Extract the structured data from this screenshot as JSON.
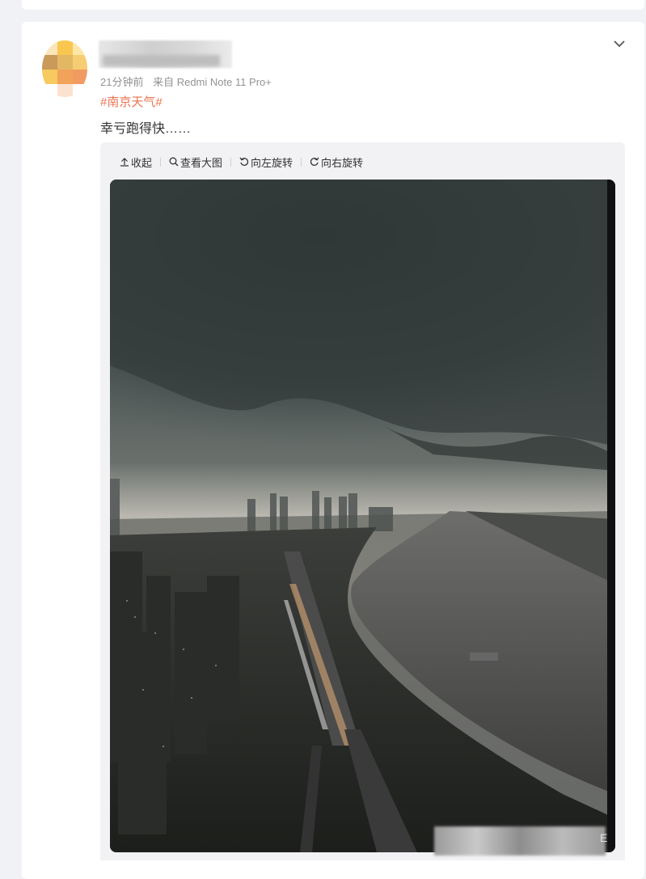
{
  "post": {
    "time": "21分钟前",
    "source": "来自 Redmi Note 11 Pro+",
    "hashtag": "#南京天气#",
    "text": "幸亏跑得快……"
  },
  "toolbar": {
    "collapse": "收起",
    "view_large": "查看大图",
    "rotate_left": "向左旋转",
    "rotate_right": "向右旋转"
  },
  "photo": {
    "description_icon": "storm-cloud-city-river-photo",
    "watermark_char": "E"
  },
  "colors": {
    "hashtag": "#eb7350",
    "meta": "#939393"
  }
}
